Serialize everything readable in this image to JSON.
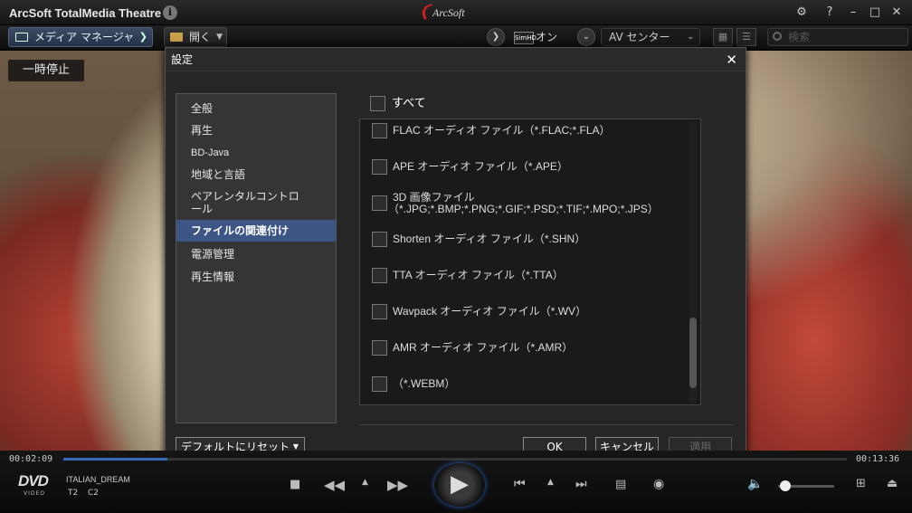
{
  "window": {
    "title": "ArcSoft TotalMedia Theatre",
    "brand": "ArcSoft"
  },
  "toolbar": {
    "media_manager": "メディア マネージャ",
    "open": "開く",
    "simhd_badge": "SimHD",
    "simhd_state": "オン",
    "audio_mode": "AV センター",
    "search_placeholder": "検索"
  },
  "video": {
    "status_label": "一時停止"
  },
  "dialog": {
    "title": "設定",
    "nav": [
      {
        "label": "全般",
        "active": false
      },
      {
        "label": "再生",
        "active": false
      },
      {
        "label": "BD-Java",
        "active": false
      },
      {
        "label": "地域と言語",
        "active": false
      },
      {
        "label": "ペアレンタルコントロール",
        "active": false
      },
      {
        "label": "ファイルの関連付け",
        "active": true
      },
      {
        "label": "電源管理",
        "active": false
      },
      {
        "label": "再生情報",
        "active": false
      }
    ],
    "select_all": "すべて",
    "file_types": [
      {
        "label": "FLAC オーディオ ファイル（*.FLAC;*.FLA）",
        "checked": false
      },
      {
        "label": "APE オーディオ ファイル（*.APE）",
        "checked": false
      },
      {
        "label": "3D 画像ファイル",
        "label2": "（*.JPG;*.BMP;*.PNG;*.GIF;*.PSD;*.TIF;*.MPO;*.JPS）",
        "checked": false
      },
      {
        "label": "Shorten オーディオ ファイル（*.SHN）",
        "checked": false
      },
      {
        "label": "TTA オーディオ ファイル（*.TTA）",
        "checked": false
      },
      {
        "label": "Wavpack オーディオ ファイル（*.WV）",
        "checked": false
      },
      {
        "label": "AMR オーディオ ファイル（*.AMR）",
        "checked": false
      },
      {
        "label": "（*.WEBM）",
        "checked": false
      }
    ],
    "scroll_position": 0.85,
    "reset_label": "デフォルトにリセット",
    "ok_label": "OK",
    "cancel_label": "キャンセル",
    "apply_label": "適用"
  },
  "player": {
    "elapsed": "00:02:09",
    "total": "00:13:36",
    "progress": 0.133,
    "disc_title": "ITALIAN_DREAM",
    "dvd_logo": "DVD",
    "dvd_sub": "VIDEO",
    "title_num": "T2",
    "chapter_num": "C2",
    "volume": 0.05
  },
  "colors": {
    "accent": "#3c5585",
    "seek": "#3a6cb8"
  }
}
